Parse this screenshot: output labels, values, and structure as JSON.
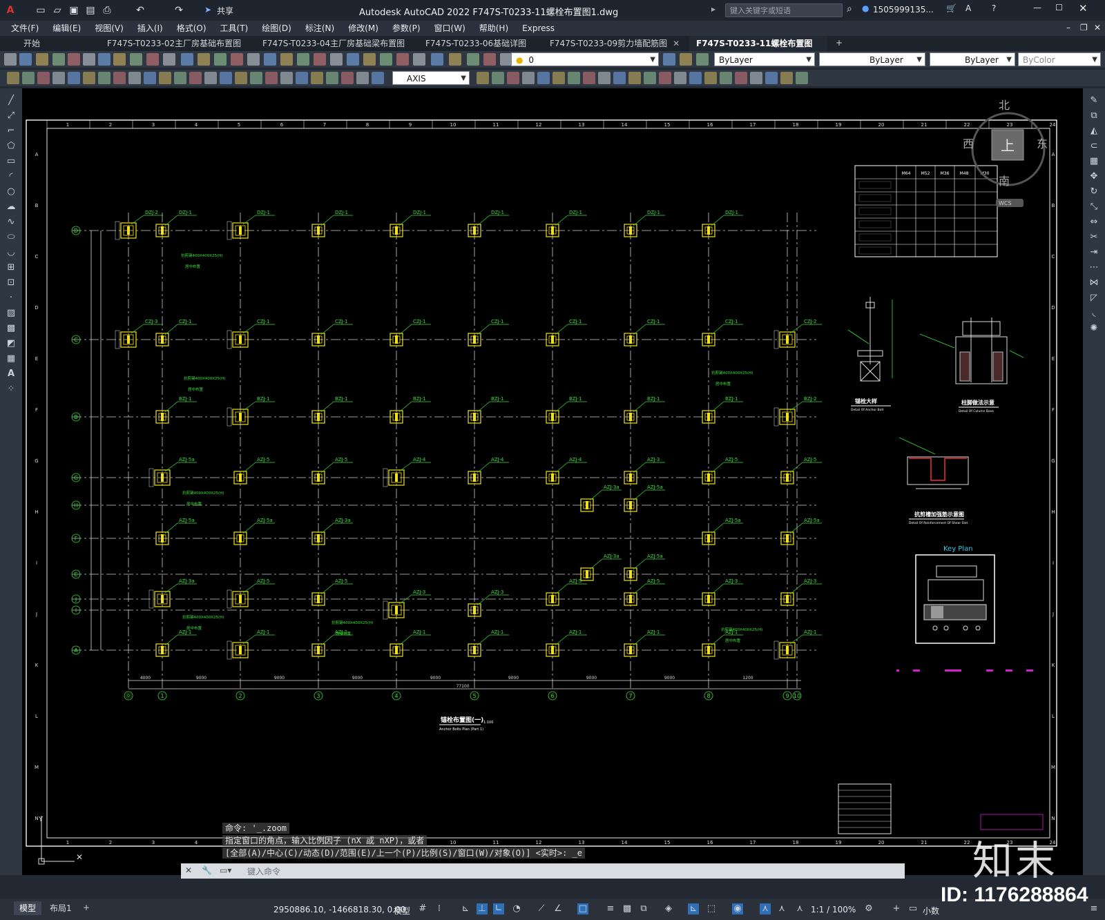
{
  "app": {
    "title": "Autodesk AutoCAD 2022    F747S-T0233-11螺栓布置图1.dwg",
    "search_placeholder": "键入关键字或短语",
    "user": "1505999135...",
    "share_label": "共享"
  },
  "menu": [
    "文件(F)",
    "编辑(E)",
    "视图(V)",
    "插入(I)",
    "格式(O)",
    "工具(T)",
    "绘图(D)",
    "标注(N)",
    "修改(M)",
    "参数(P)",
    "窗口(W)",
    "帮助(H)",
    "Express"
  ],
  "tabs": [
    {
      "label": "开始"
    },
    {
      "label": "F747S-T0233-02主厂房基础布置图1"
    },
    {
      "label": "F747S-T0233-04主厂房基础梁布置图1"
    },
    {
      "label": "F747S-T0233-06基础详图1"
    },
    {
      "label": "F747S-T0233-09剪力墙配筋图"
    },
    {
      "label": "F747S-T0233-11螺栓布置图1*"
    }
  ],
  "toolbar": {
    "layer_value": "0",
    "color_value": "ByLayer",
    "linetype_value": "ByLayer",
    "lineweight_value": "ByLayer",
    "plotstyle_value": "ByColor",
    "dimstyle_value": "AXIS"
  },
  "drawing": {
    "top_ruler": [
      "1",
      "2",
      "3",
      "4",
      "5",
      "6",
      "7",
      "8",
      "9",
      "10",
      "11",
      "12",
      "13",
      "14",
      "15",
      "16",
      "17",
      "18",
      "19",
      "20",
      "21",
      "22",
      "23",
      "24"
    ],
    "side_ruler": [
      "A",
      "B",
      "C",
      "D",
      "E",
      "F",
      "G",
      "H",
      "I",
      "J",
      "K",
      "L",
      "M",
      "N"
    ],
    "grid_cols": [
      "⓪",
      "1",
      "2",
      "3",
      "4",
      "5",
      "6",
      "7",
      "8",
      "9",
      "10"
    ],
    "grid_rows": [
      "D",
      "C",
      "B",
      "G",
      "H",
      "F",
      "E",
      "J",
      "I",
      "A"
    ],
    "top_dims": [
      "4000",
      "9000",
      "9000",
      "9000",
      "9000",
      "9000",
      "9000",
      "9000",
      "1200"
    ],
    "total_dim": "77100",
    "plan_title": "锚栓布置图(一)",
    "plan_subtitle": "Anchor Bolts Plan (Part 1)",
    "plan_scale": "1:100",
    "labels": {
      "dzj1": "DZJ-1",
      "dzj2": "DZJ-2",
      "czj1": "CZJ-1",
      "czj2": "CZJ-2",
      "czj3": "CZJ-3",
      "bzj1": "BZJ-1",
      "bzj2": "BZJ-2",
      "azj1": "AZJ-1",
      "azj3": "AZJ-3",
      "azj3a": "AZJ-3a",
      "azj4": "AZJ-4",
      "azj5": "AZJ-5",
      "azj5a": "AZJ-5a",
      "note_shear": "抗剪键400X400X25(H)",
      "note_center": "居中布置"
    },
    "detail1_title": "锚栓大样",
    "detail1_sub": "Detail Of Anchor Bolt",
    "detail2_title": "柱脚做法示意",
    "detail2_sub": "Detail Of Column Base",
    "detail3_title": "抗剪槽加强筋示意图",
    "detail3_sub": "Detail Of Reinforcement Of Shear Slot",
    "keyplan_title": "Key Plan",
    "table_cols": [
      "M64",
      "M52",
      "M36",
      "M48",
      "M30"
    ],
    "compass": {
      "north": "北",
      "south": "南",
      "east": "东",
      "west": "西",
      "center": "上",
      "wcs": "WCS"
    }
  },
  "command": {
    "history": [
      "命令:  '_.zoom",
      "指定窗口的角点，输入比例因子 (nX 或 nXP)，或者",
      "[全部(A)/中心(C)/动态(D)/范围(E)/上一个(P)/比例(S)/窗口(W)/对象(O)] <实时>: _e"
    ],
    "input_placeholder": "键入命令"
  },
  "status": {
    "layout_tabs": [
      "模型",
      "布局1"
    ],
    "coordinates": "2950886.10, -1466818.30, 0.00",
    "model_label": "模型",
    "scale": "1:1 / 100%",
    "units": "小数"
  },
  "watermark": {
    "id": "ID: 1176288864",
    "logo": "知末"
  }
}
